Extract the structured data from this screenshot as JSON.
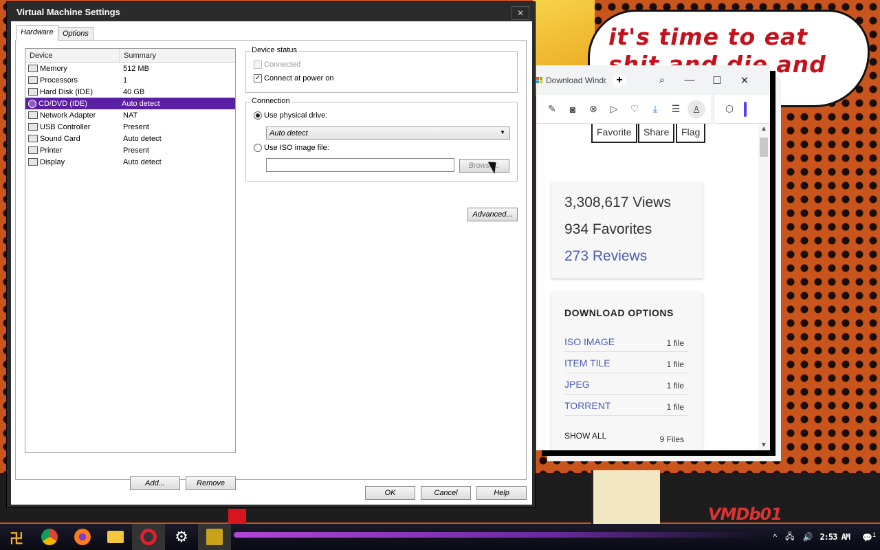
{
  "background": {
    "speech_bubble_text": "it's time to eat shit and die and chew",
    "corner_logo": "VMDb01"
  },
  "browser": {
    "tab_title": "Download Windows",
    "new_tab": "+",
    "stats": {
      "views": "3,308,617 Views",
      "favorites": "934 Favorites",
      "reviews": "273 Reviews"
    },
    "action_buttons": [
      "Favorite",
      "Share",
      "Flag"
    ],
    "download_options": {
      "title": "DOWNLOAD OPTIONS",
      "items": [
        {
          "name": "ISO IMAGE",
          "count": "1 file"
        },
        {
          "name": "ITEM TILE",
          "count": "1 file"
        },
        {
          "name": "JPEG",
          "count": "1 file"
        },
        {
          "name": "TORRENT",
          "count": "1 file"
        }
      ],
      "show_all": "SHOW ALL",
      "show_all_count": "9 Files"
    }
  },
  "dialog": {
    "title": "Virtual Machine Settings",
    "tabs": [
      "Hardware",
      "Options"
    ],
    "columns": {
      "device": "Device",
      "summary": "Summary"
    },
    "devices": [
      {
        "name": "Memory",
        "summary": "512 MB",
        "icon": "memory-icon"
      },
      {
        "name": "Processors",
        "summary": "1",
        "icon": "processor-icon"
      },
      {
        "name": "Hard Disk (IDE)",
        "summary": "40 GB",
        "icon": "hard-disk-icon"
      },
      {
        "name": "CD/DVD (IDE)",
        "summary": "Auto detect",
        "icon": "cd-dvd-icon",
        "selected": true
      },
      {
        "name": "Network Adapter",
        "summary": "NAT",
        "icon": "network-icon"
      },
      {
        "name": "USB Controller",
        "summary": "Present",
        "icon": "usb-icon"
      },
      {
        "name": "Sound Card",
        "summary": "Auto detect",
        "icon": "sound-icon"
      },
      {
        "name": "Printer",
        "summary": "Present",
        "icon": "printer-icon"
      },
      {
        "name": "Display",
        "summary": "Auto detect",
        "icon": "display-icon"
      }
    ],
    "add_label": "Add...",
    "remove_label": "Remove",
    "device_status": {
      "label": "Device status",
      "connected": "Connected",
      "connect_at_power_on": "Connect at power on"
    },
    "connection": {
      "label": "Connection",
      "use_physical": "Use physical drive:",
      "physical_value": "Auto detect",
      "use_iso": "Use ISO image file:",
      "iso_value": "",
      "browse": "Browse..."
    },
    "advanced_label": "Advanced...",
    "ok_label": "OK",
    "cancel_label": "Cancel",
    "help_label": "Help"
  },
  "taskbar": {
    "clock": "2:53 AM",
    "notification_count": "1"
  }
}
